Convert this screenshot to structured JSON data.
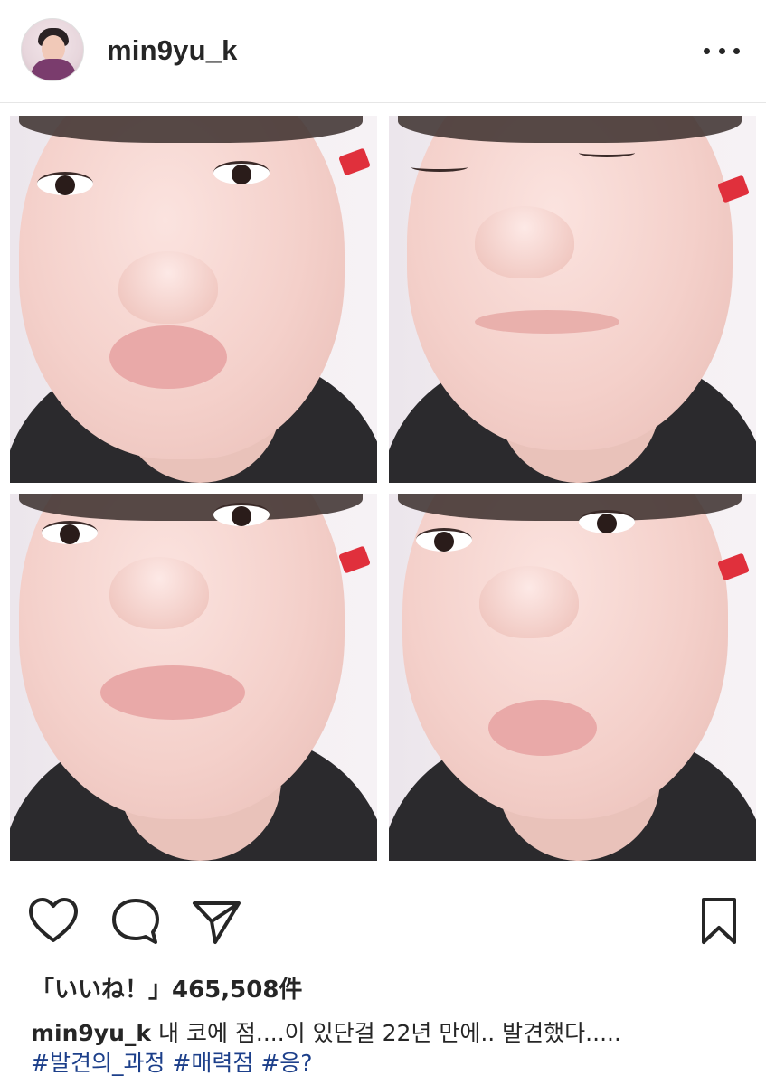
{
  "post": {
    "username": "min9yu_k"
  },
  "likes": {
    "text": "「いいね！」465,508件"
  },
  "caption": {
    "username": "min9yu_k",
    "text": "내 코에 점....이 있단걸 22년 만에.. 발견했다.....",
    "hashtags": [
      "#발견의_과정",
      "#매력점",
      "#응?"
    ]
  },
  "icons": {
    "more": "more-horizontal-icon",
    "like": "heart-icon",
    "comment": "comment-icon",
    "share": "share-paper-plane-icon",
    "save": "bookmark-icon"
  },
  "colors": {
    "text": "#262626",
    "hashtag": "#1c3f8a",
    "divider": "#e6e6e6"
  }
}
